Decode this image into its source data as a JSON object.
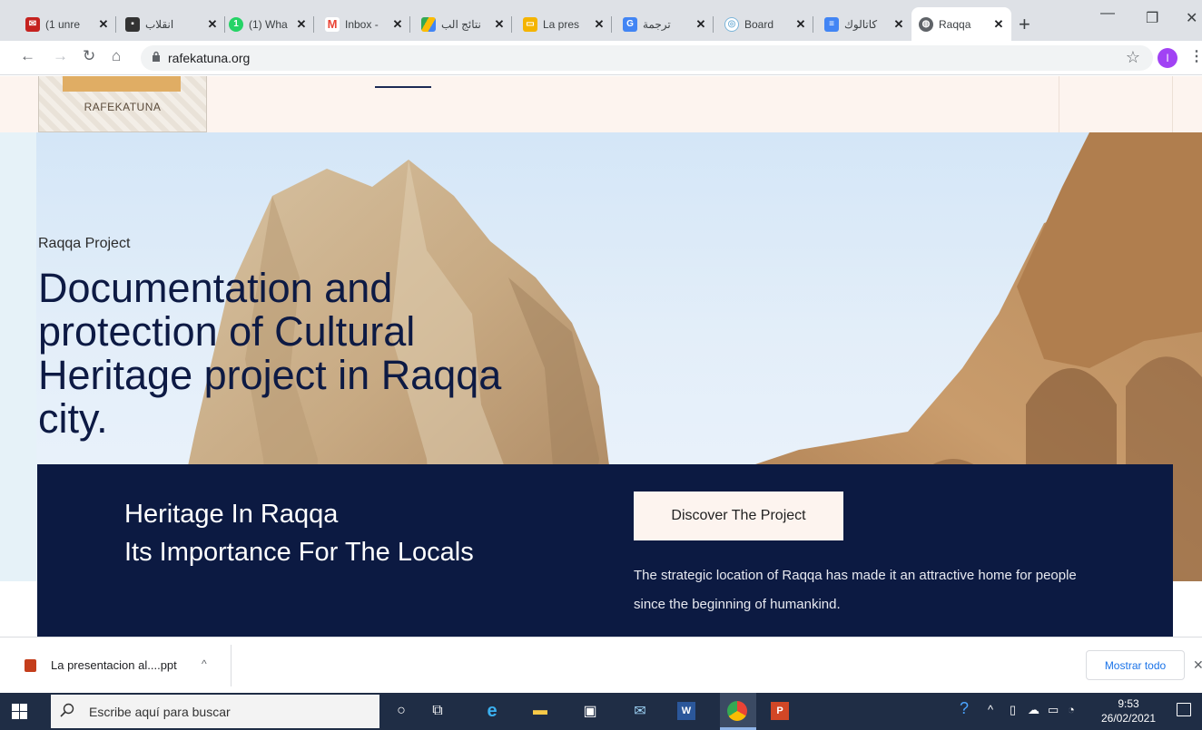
{
  "browser": {
    "tabs": [
      {
        "title": "(1 unre",
        "icon": "mail-icon",
        "color": "#c5221f"
      },
      {
        "title": "انقلاب",
        "icon": "news-icon",
        "color": "#333333"
      },
      {
        "title": "(1) Wha",
        "icon": "whatsapp-icon",
        "color": "#25d366"
      },
      {
        "title": "Inbox -",
        "icon": "gmail-icon",
        "color": "#ea4335"
      },
      {
        "title": "نتائج الب",
        "icon": "drive-icon",
        "color": "#34a853"
      },
      {
        "title": "La pres",
        "icon": "slides-icon",
        "color": "#f4b400"
      },
      {
        "title": "ترجمة",
        "icon": "translate-icon",
        "color": "#4285f4"
      },
      {
        "title": "Board",
        "icon": "board-icon",
        "color": "#7cb5d9"
      },
      {
        "title": "كاتالوك",
        "icon": "docs-icon",
        "color": "#4285f4"
      },
      {
        "title": "Raqqa",
        "icon": "globe-icon",
        "color": "#5f6368",
        "active": true
      }
    ],
    "url": "rafekatuna.org",
    "profile_initial": "I"
  },
  "site": {
    "logo_text": "RAFEKATUNA",
    "hero": {
      "eyebrow": "Raqqa Project",
      "title": "Documentation and protection of Cultural Heritage project in Raqqa city."
    },
    "band": {
      "title_line1": "Heritage In Raqqa",
      "title_line2": "Its Importance For The Locals",
      "cta_label": "Discover The Project",
      "text": "The strategic location of Raqqa has made it an attractive home for people since the beginning of humankind."
    }
  },
  "downloads": {
    "file_name": "La presentacion al....ppt",
    "show_all": "Mostrar todo"
  },
  "taskbar": {
    "search_placeholder": "Escribe aquí para buscar",
    "time": "9:53",
    "date": "26/02/2021"
  }
}
